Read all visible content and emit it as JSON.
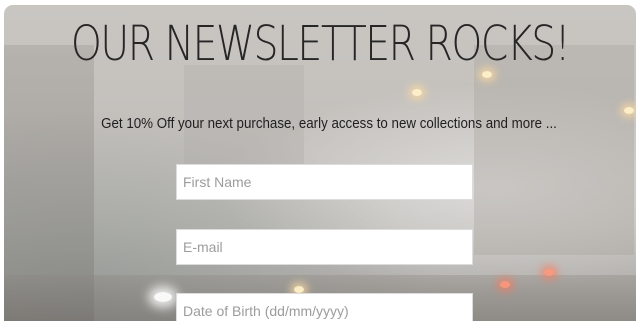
{
  "newsletter": {
    "title": "OUR NEWSLETTER ROCKS!",
    "subtitle": "Get 10% Off your next purchase, early access to new collections and more ...",
    "fields": [
      {
        "placeholder": "First Name",
        "value": ""
      },
      {
        "placeholder": "E-mail",
        "value": ""
      },
      {
        "placeholder": "Date of Birth (dd/mm/yyyy)",
        "value": ""
      }
    ]
  },
  "colors": {
    "title_text": "#262626",
    "body_text": "#1f1f1f",
    "field_background": "#ffffff",
    "placeholder_text": "#9c9c9c"
  }
}
